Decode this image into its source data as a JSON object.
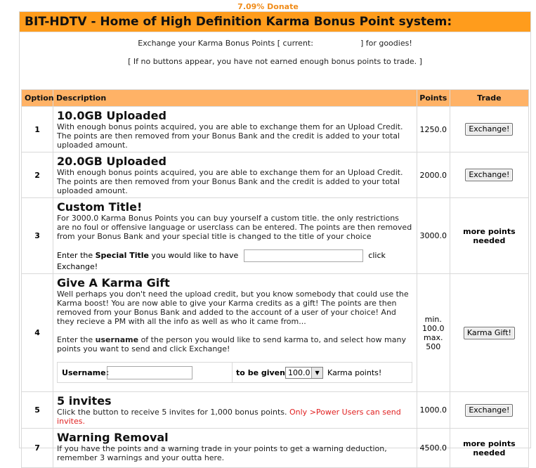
{
  "donate": "7.09% Donate",
  "header": {
    "title": "BIT-HDTV - Home of High Definition Karma Bonus Point system:"
  },
  "info": {
    "line1_prefix": "Exchange your Karma Bonus Points [ current:",
    "line1_suffix": "] for goodies!",
    "line2": "[ If no buttons appear, you have not earned enough bonus points to trade. ]"
  },
  "table": {
    "headers": {
      "option": "Option",
      "description": "Description",
      "points": "Points",
      "trade": "Trade"
    },
    "rows": [
      {
        "option": "1",
        "title": "10.0GB Uploaded",
        "text": "With enough bonus points acquired, you are able to exchange them for an Upload Credit. The points are then removed from your Bonus Bank and the credit is added to your total uploaded amount.",
        "points": "1250.0",
        "trade": "Exchange!"
      },
      {
        "option": "2",
        "title": "20.0GB Uploaded",
        "text": "With enough bonus points acquired, you are able to exchange them for an Upload Credit. The points are then removed from your Bonus Bank and the credit is added to your total uploaded amount.",
        "points": "2000.0",
        "trade": "Exchange!"
      },
      {
        "option": "3",
        "title": "Custom Title!",
        "text": "For 3000.0 Karma Bonus Points you can buy yourself a custom title. the only restrictions are no foul or offensive language or userclass can be entered. The points are then removed from your Bonus Bank and your special title is changed to the title of your choice",
        "form_prefix": "Enter the",
        "form_bold": "Special Title",
        "form_mid": "you would like to have",
        "form_suffix": "click Exchange!",
        "points": "3000.0",
        "trade": "more points needed"
      },
      {
        "option": "4",
        "title": "Give A Karma Gift",
        "text": "Well perhaps you don't need the upload credit, but you know somebody that could use the Karma boost! You are now able to give your Karma credits as a gift! The points are then removed from your Bonus Bank and added to the account of a user of your choice! And they recieve a PM with all the info as well as who it came from...",
        "text2_prefix": "Enter the",
        "text2_bold": "username",
        "text2_suffix": "of the person you would like to send karma to, and select how many points you want to send and click Exchange!",
        "username_label": "Username:",
        "given_label": "to be given:",
        "given_value": "100.0",
        "karma_label": "Karma points!",
        "points_l1": "min.",
        "points_l2": "100.0",
        "points_l3": "max.",
        "points_l4": "500",
        "trade": "Karma Gift!"
      },
      {
        "option": "5",
        "title": "5 invites",
        "text": "Click the button to receive 5 invites for 1,000 bonus points.",
        "warn": "Only >Power Users can send invites.",
        "points": "1000.0",
        "trade": "Exchange!"
      },
      {
        "option": "7",
        "title": "Warning Removal",
        "text": "If you have the points and a warning trade in your points to get a warning deduction, remember 3 warnings and your outta here.",
        "points": "4500.0",
        "trade": "more points needed"
      }
    ]
  },
  "colors": {
    "title_bar": "#ff9c1c",
    "table_header": "#ffb266",
    "donate": "#f08c1a",
    "warning_text": "#e02020"
  }
}
